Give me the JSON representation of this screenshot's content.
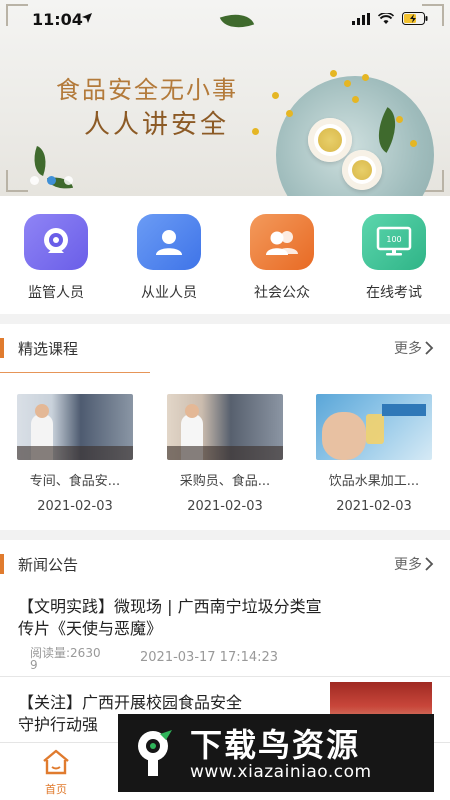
{
  "status": {
    "time": "11:04"
  },
  "banner": {
    "slogan_line1": "食品安全无小事",
    "slogan_line2": "人人讲安全",
    "slide_count": 3,
    "active_slide": 2
  },
  "menu": [
    {
      "label": "监管人员",
      "icon": "webcam-icon",
      "color": "#7b6ff0"
    },
    {
      "label": "从业人员",
      "icon": "person-icon",
      "color": "#4f86f0"
    },
    {
      "label": "社会公众",
      "icon": "people-icon",
      "color": "#ef7e3a"
    },
    {
      "label": "在线考试",
      "icon": "monitor-exam-icon",
      "color": "#3fc39a"
    }
  ],
  "courses": {
    "title": "精选课程",
    "more": "更多",
    "items": [
      {
        "title": "专间、食品安...",
        "date": "2021-02-03"
      },
      {
        "title": "采购员、食品...",
        "date": "2021-02-03"
      },
      {
        "title": "饮品水果加工...",
        "date": "2021-02-03"
      }
    ]
  },
  "news": {
    "title": "新闻公告",
    "more": "更多",
    "items": [
      {
        "title_line1": "【文明实践】微现场 | 广西南宁垃圾分类宣",
        "title_line2": "传片《天使与恶魔》",
        "reads_line1": "阅读量:2630",
        "reads_line2": "9",
        "datetime": "2021-03-17 17:14:23"
      },
      {
        "title_line1": "【关注】广西开展校园食品安全",
        "title_line2": "守护行动强"
      }
    ]
  },
  "tabbar": {
    "home_label": "首页"
  },
  "watermark": {
    "title": "下载鸟资源",
    "url": "www.xiazainiao.com"
  },
  "colors": {
    "accent": "#e07b2e",
    "active_dot": "#3f8fd6"
  }
}
